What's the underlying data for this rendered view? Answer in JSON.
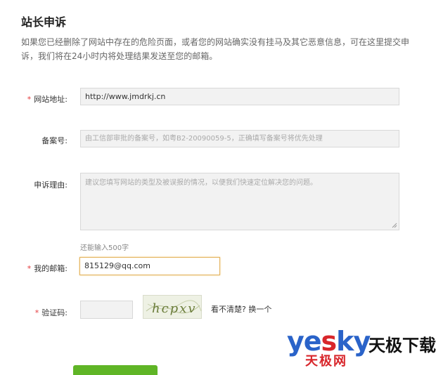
{
  "page": {
    "title": "站长申诉",
    "intro": "如果您已经删除了网站中存在的危险页面，或者您的网站确实没有挂马及其它恶意信息，可在这里提交申诉，我们将在24小时内将处理结果发送至您的邮箱。"
  },
  "form": {
    "required_mark": "*",
    "website": {
      "label": "网站地址:",
      "value": "http://www.jmdrkj.cn"
    },
    "icp": {
      "label": "备案号:",
      "placeholder": "由工信部审批的备案号，如粤B2-20090059-5，正确填写备案号将优先处理"
    },
    "reason": {
      "label": "申诉理由:",
      "placeholder": "建议您填写网站的类型及被误报的情况，以便我们快速定位解决您的问题。",
      "hint": "还能输入500字"
    },
    "email": {
      "label": "我的邮箱:",
      "value": "815129@qq.com"
    },
    "captcha": {
      "label": "验证码:",
      "value": "",
      "image_text": "hcpxv",
      "unclear": "看不清楚?",
      "refresh": "换一个"
    }
  },
  "watermark": {
    "ye": "ye",
    "s": "s",
    "ky": "ky",
    "tianji_small": "天极网",
    "download": "天极下载"
  },
  "colors": {
    "required": "#e4393c",
    "focus_border": "#e3b25c",
    "submit": "#5fb526",
    "logo_blue": "#2a63c9",
    "logo_red": "#d8262b"
  }
}
